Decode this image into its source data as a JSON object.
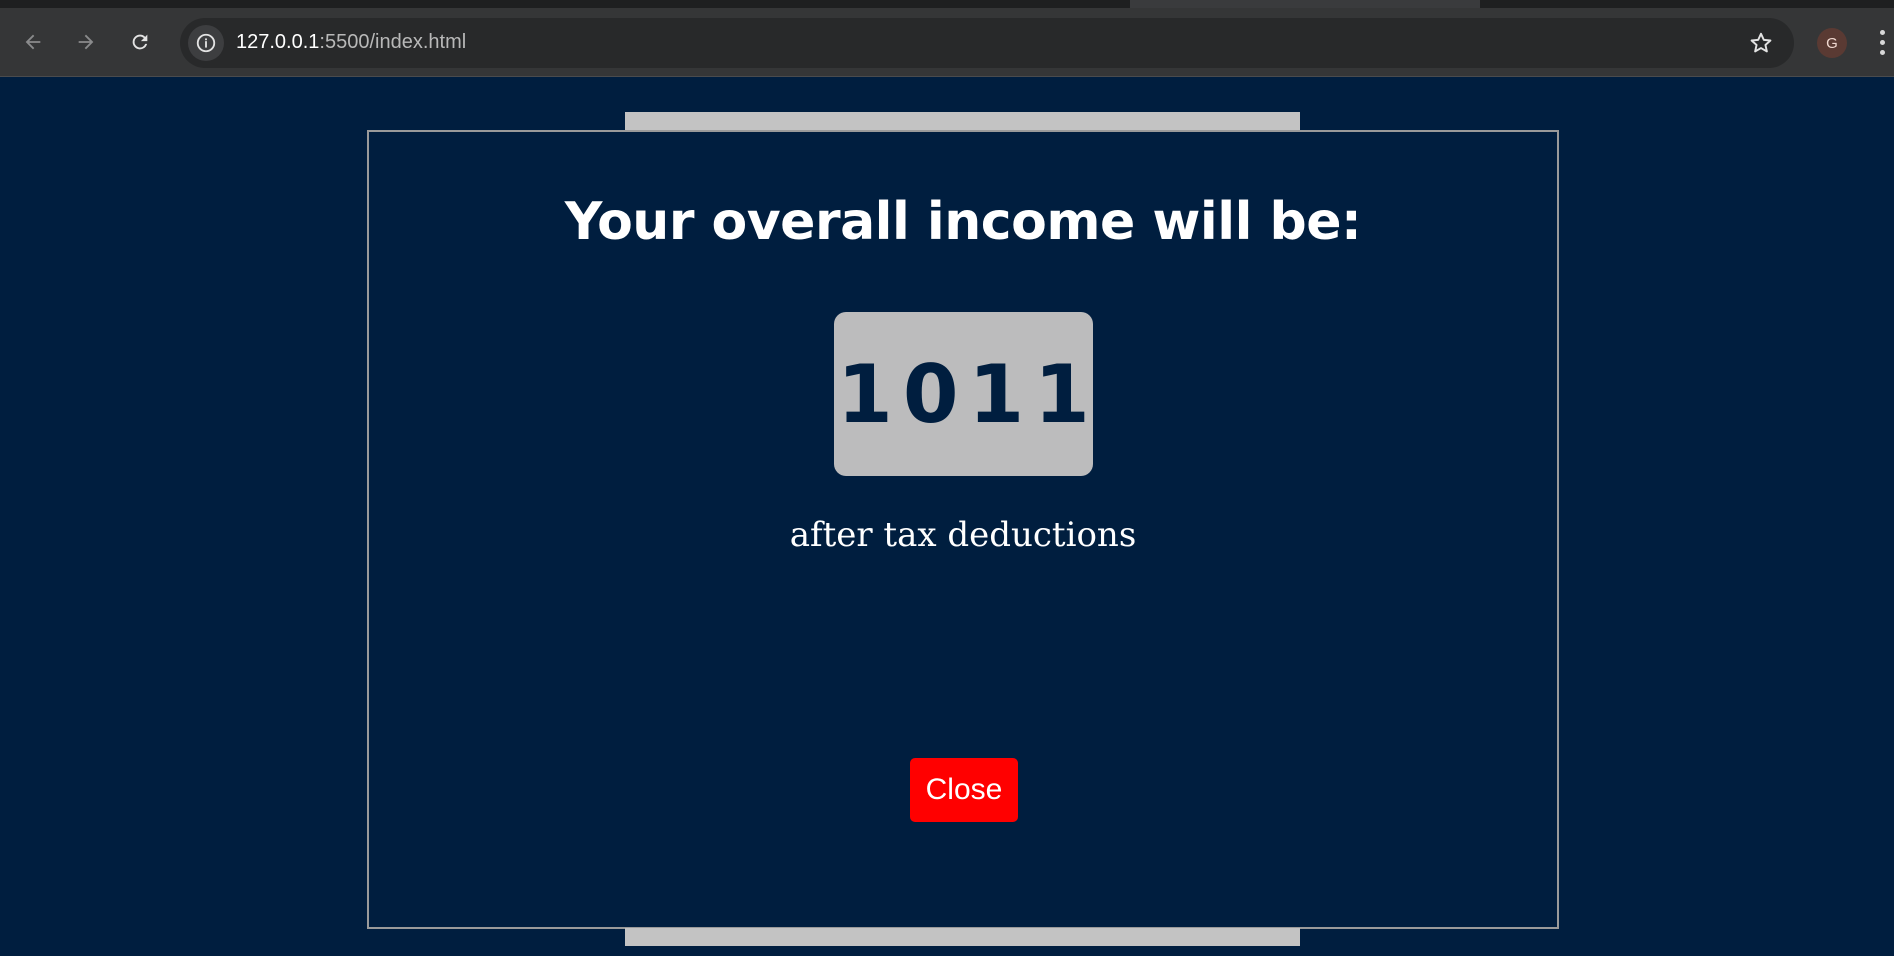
{
  "browser": {
    "url_host": "127.0.0.1",
    "url_rest": ":5500/index.html",
    "profile_initial": "G",
    "icons": [
      "back-arrow-icon",
      "forward-arrow-icon",
      "reload-icon",
      "site-info-icon",
      "bookmark-star-icon",
      "kebab-menu-icon"
    ]
  },
  "modal": {
    "title": "Your overall income will be:",
    "result_value": "1011",
    "caption": "after tax deductions",
    "close_label": "Close"
  },
  "colors": {
    "page_background": "#001e3f",
    "result_box": "#bcbcbd",
    "close_button": "#ff0000",
    "accent_bars": "#c3c3c3"
  }
}
